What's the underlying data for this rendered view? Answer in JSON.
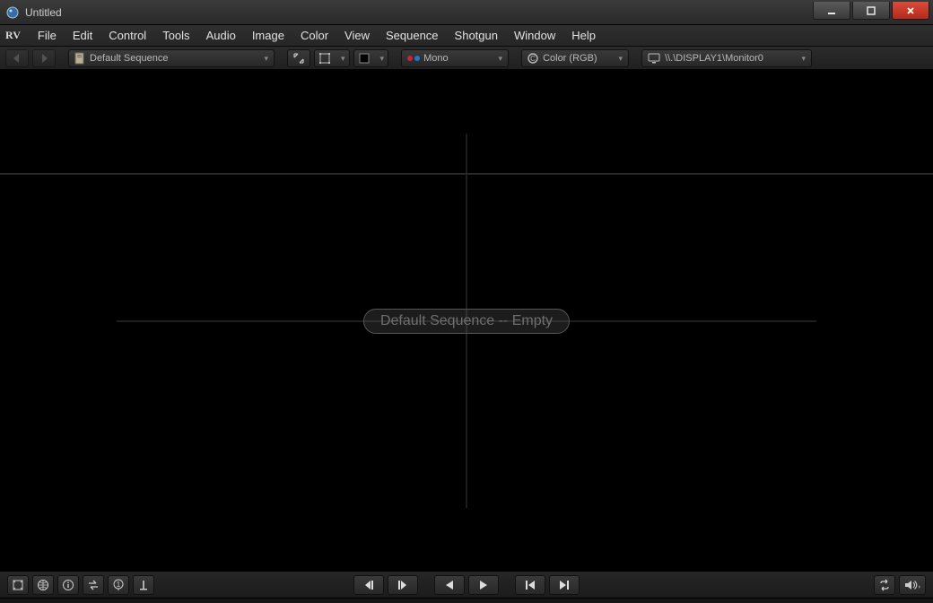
{
  "window": {
    "title": "Untitled"
  },
  "menu": {
    "logo": "RV",
    "items": [
      "File",
      "Edit",
      "Control",
      "Tools",
      "Audio",
      "Image",
      "Color",
      "View",
      "Sequence",
      "Shotgun",
      "Window",
      "Help"
    ]
  },
  "toolbar": {
    "sequence_selector": "Default Sequence",
    "channels": "Mono",
    "color_mode": "Color (RGB)",
    "display": "\\\\.\\DISPLAY1\\Monitor0"
  },
  "viewport": {
    "overlay_text": "Default Sequence -- Empty"
  }
}
